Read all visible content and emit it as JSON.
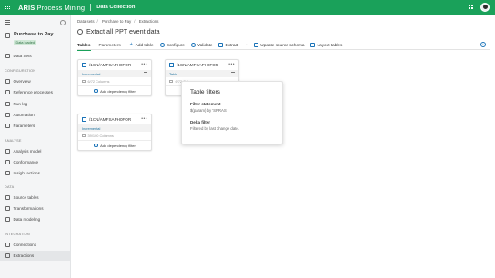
{
  "topbar": {
    "brand_bold": "ARIS",
    "brand_light": "Process Mining",
    "module": "Data Collection",
    "accent": "#1aa15a"
  },
  "sidebar": {
    "project_title": "Purchase to Pay",
    "project_badge": "Data loaded",
    "items": [
      {
        "label": "Data Sets",
        "icon": "back-arrow-icon"
      },
      {
        "label": "Overview",
        "icon": "overview-icon"
      },
      {
        "label": "Reference processes",
        "icon": "process-icon"
      },
      {
        "label": "Run log",
        "icon": "log-icon"
      },
      {
        "label": "Automation",
        "icon": "automation-icon"
      },
      {
        "label": "Parameters",
        "icon": "parameters-icon"
      },
      {
        "label": "Analysis model",
        "icon": "model-icon"
      },
      {
        "label": "Conformance",
        "icon": "conformance-icon"
      },
      {
        "label": "Insight actions",
        "icon": "insight-icon"
      },
      {
        "label": "Source tables",
        "icon": "table-icon"
      },
      {
        "label": "Transformations",
        "icon": "transform-icon"
      },
      {
        "label": "Data modeling",
        "icon": "modeling-icon"
      },
      {
        "label": "Connections",
        "icon": "connection-icon"
      },
      {
        "label": "Extractions",
        "icon": "extraction-icon"
      }
    ],
    "sections": {
      "configuration": "CONFIGURATION",
      "analyse": "ANALYSE",
      "data": "DATA",
      "integration": "INTEGRATION"
    }
  },
  "main": {
    "breadcrumb": [
      "Data sets",
      "Purchase to Pay",
      "Extractions"
    ],
    "title": "Extact all PPT event data",
    "tabs": [
      "Tables",
      "Parameters"
    ],
    "toolbar": {
      "add_table": "Add table",
      "configure": "Configure",
      "validate": "Validate",
      "extract": "Extract",
      "update_schema": "Update source schema",
      "layout_tables": "Layout tables"
    },
    "cards": [
      {
        "name": "/1CN/AMFSAPH0FOR",
        "tag": "Incremental",
        "columns": "6/72 Columns",
        "footer": "Add dependency filter"
      },
      {
        "name": "/1CN/AMFSAPH0FOR",
        "tag": "Table",
        "columns": "6/72 Columns",
        "footer": ""
      },
      {
        "name": "/1CN/AMFSAPH0FOR",
        "tag": "Incremental",
        "columns": "39/100 Columns",
        "footer": "Add dependency filter"
      }
    ],
    "popup": {
      "title": "Table filters",
      "filter_label": "Filter statement",
      "filter_value": "$(param) by 'SPRAS'",
      "delta_label": "Delta filter",
      "delta_value": "Filtered by last change date."
    }
  }
}
